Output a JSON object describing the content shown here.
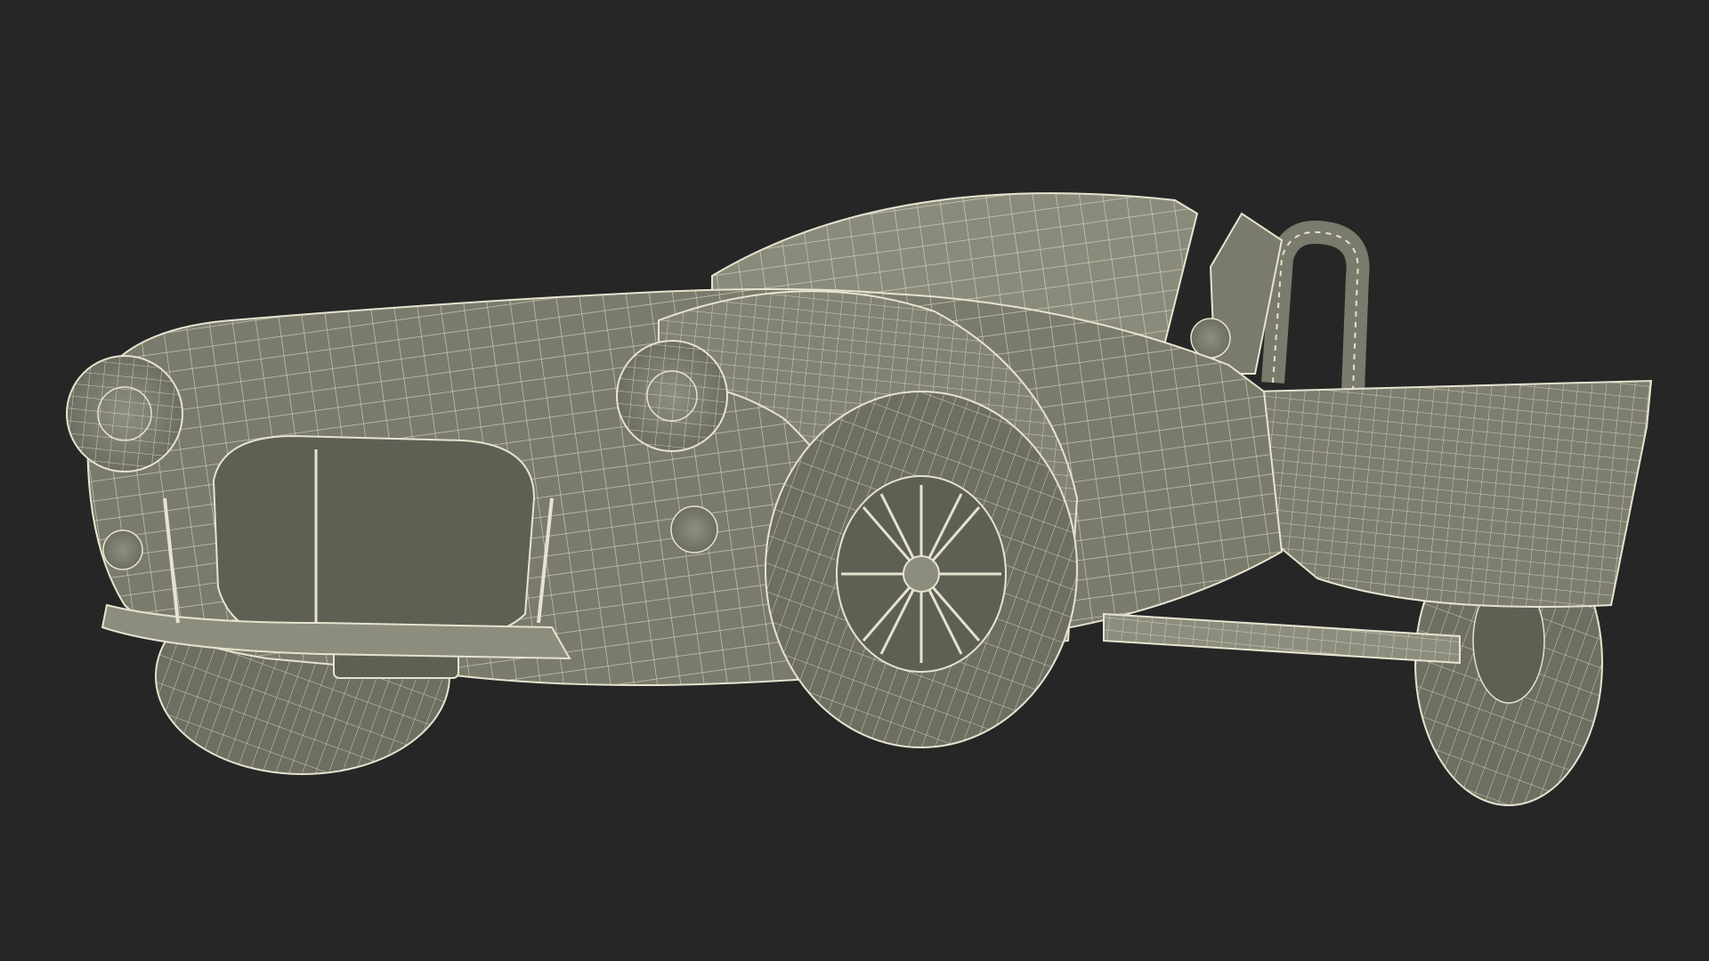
{
  "scene": {
    "subject": "wireframe-roadster-model",
    "colors": {
      "background": "#262626",
      "surface": "#7a7b6c",
      "surface_dark": "#5f6054",
      "surface_light": "#8c8d7d",
      "wire": "#e6e3cf",
      "shadow": "#3e3f37"
    }
  }
}
